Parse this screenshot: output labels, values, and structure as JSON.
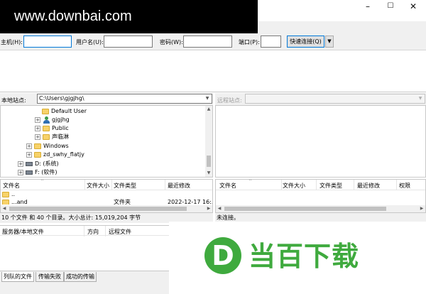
{
  "watermark": "www.downbai.com",
  "window_controls": {
    "minimize": "–",
    "maximize": "☐",
    "close": "✕"
  },
  "quickconnect": {
    "host_label": "主机(H):",
    "user_label": "用户名(U):",
    "password_label": "密码(W):",
    "port_label": "端口(P):",
    "connect_label": "快速连接(Q)",
    "dropdown_glyph": "▼"
  },
  "local": {
    "site_label": "本地站点:",
    "path": "C:\\Users\\gjgjhg\\",
    "tree": [
      {
        "label": "Default User",
        "icon": "folder-icon",
        "expander": ""
      },
      {
        "label": "gjgjhg",
        "icon": "user-icon",
        "expander": "+"
      },
      {
        "label": "Public",
        "icon": "folder-icon",
        "expander": "+"
      },
      {
        "label": "声临淋",
        "icon": "folder-icon",
        "expander": "+"
      },
      {
        "label": "Windows",
        "icon": "folder-icon",
        "expander": "+"
      },
      {
        "label": "zd_swhy_flatjy",
        "icon": "folder-icon",
        "expander": "+"
      },
      {
        "label": "D: (系统)",
        "icon": "drive-icon",
        "expander": "+"
      },
      {
        "label": "F: (软件)",
        "icon": "drive-icon",
        "expander": "+"
      }
    ],
    "columns": [
      "文件名",
      "文件大小",
      "文件类型",
      "最近修改"
    ],
    "rows": [
      {
        "name": "..",
        "type": "",
        "modified": ""
      },
      {
        "name": "...and",
        "type": "文件夹",
        "modified": "2022-12-17 16:..."
      }
    ],
    "status": "10 个文件 和 40 个目录。大小总计: 15,019,204 字节"
  },
  "remote": {
    "site_label": "远程站点:",
    "columns": [
      "文件名",
      "文件大小",
      "文件类型",
      "最近修改",
      "权限"
    ],
    "status": "未连接。"
  },
  "queue": {
    "columns": [
      "服务器/本地文件",
      "方向",
      "远程文件"
    ]
  },
  "tabs": [
    {
      "label": "列队的文件",
      "active": true
    },
    {
      "label": "传输失败",
      "active": false
    },
    {
      "label": "成功的传输",
      "active": false
    }
  ],
  "logo": {
    "letter": "D",
    "text": "当百下载",
    "color": "#3faa3e"
  }
}
